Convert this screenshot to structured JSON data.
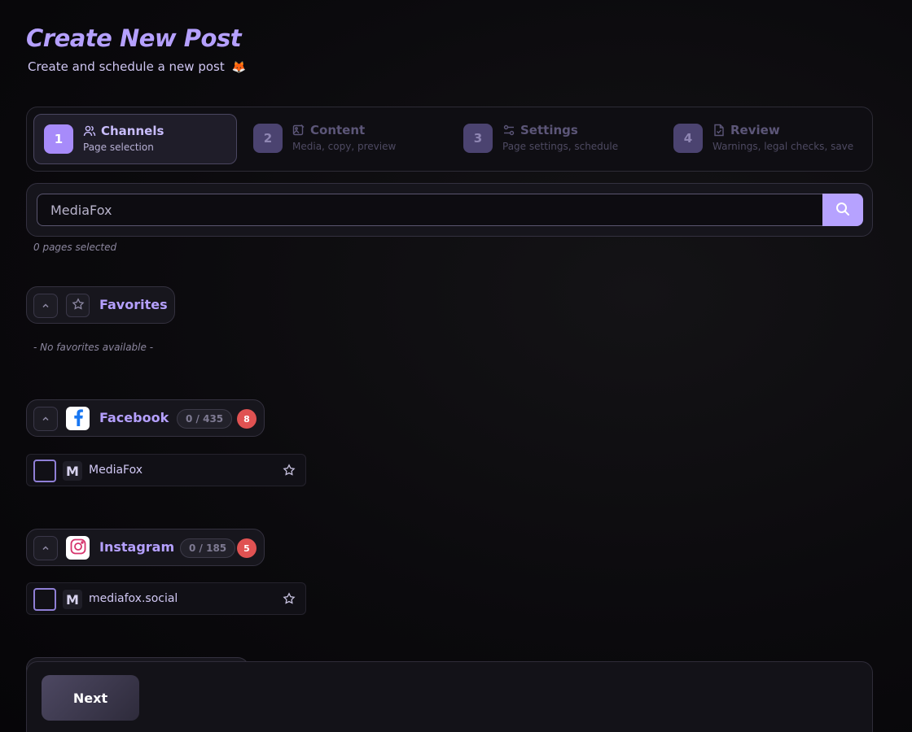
{
  "header": {
    "title": "Create New Post",
    "subtitle": "Create and schedule a new post",
    "subtitle_emoji": "🦊"
  },
  "steps": [
    {
      "number": "1",
      "title": "Channels",
      "description": "Page selection",
      "icon": "users-icon",
      "active": true
    },
    {
      "number": "2",
      "title": "Content",
      "description": "Media, copy, preview",
      "icon": "image-edit-icon",
      "active": false
    },
    {
      "number": "3",
      "title": "Settings",
      "description": "Page settings, schedule",
      "icon": "settings-sliders-icon",
      "active": false
    },
    {
      "number": "4",
      "title": "Review",
      "description": "Warnings, legal checks, save",
      "icon": "document-check-icon",
      "active": false
    }
  ],
  "search": {
    "value": "MediaFox",
    "button_icon": "search-icon"
  },
  "selected_count_text": "0 pages selected",
  "favorites": {
    "title": "Favorites",
    "empty_text": "- No favorites available -"
  },
  "facebook": {
    "title": "Facebook",
    "count": "0 / 435",
    "badge": "8",
    "pages": [
      {
        "avatar": "M",
        "name": "MediaFox"
      }
    ]
  },
  "instagram": {
    "title": "Instagram",
    "count": "0 / 185",
    "badge": "5",
    "pages": [
      {
        "avatar": "M",
        "name": "mediafox.social"
      }
    ]
  },
  "footer": {
    "next_label": "Next"
  },
  "colors": {
    "accent": "#b5a0ff",
    "badge_red": "#e05252",
    "facebook_blue": "#1877f2"
  }
}
